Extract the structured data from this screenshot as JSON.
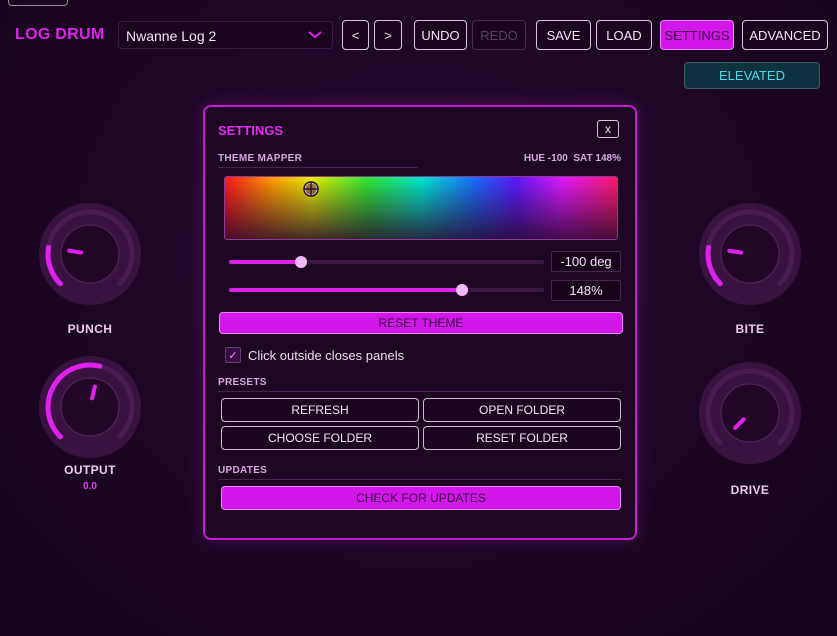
{
  "header": {
    "brand": "LOG DRUM",
    "preset_name": "Nwanne Log 2",
    "prev_label": "<",
    "next_label": ">",
    "undo_label": "UNDO",
    "redo_label": "REDO",
    "save_label": "SAVE",
    "load_label": "LOAD",
    "settings_label": "SETTINGS",
    "advanced_label": "ADVANCED",
    "mode_badge": "ELEVATED"
  },
  "knobs": [
    {
      "label": "PUNCH",
      "level": 0.2,
      "value_text": ""
    },
    {
      "label": "OUTPUT",
      "level": 0.55,
      "value_text": "0.0"
    },
    {
      "label": "BITE",
      "level": 0.2,
      "value_text": ""
    },
    {
      "label": "DRIVE",
      "level": 0.0,
      "value_text": ""
    }
  ],
  "settings": {
    "title": "SETTINGS",
    "close_label": "x",
    "theme_mapper_label": "THEME MAPPER",
    "hue_readout": "HUE -100",
    "sat_readout": "SAT 148%",
    "hue_slider": {
      "value_text": "-100 deg",
      "fraction": 0.23
    },
    "sat_slider": {
      "value_text": "148%",
      "fraction": 0.74
    },
    "reset_theme_label": "RESET THEME",
    "click_outside_label": "Click outside closes panels",
    "click_outside_checked": true,
    "presets_label": "PRESETS",
    "refresh_label": "REFRESH",
    "open_folder_label": "OPEN FOLDER",
    "choose_folder_label": "CHOOSE FOLDER",
    "reset_folder_label": "RESET FOLDER",
    "updates_label": "UPDATES",
    "check_updates_label": "CHECK FOR UPDATES"
  },
  "colors": {
    "accent": "#e020ec",
    "badge_text": "#4fd8e8"
  }
}
